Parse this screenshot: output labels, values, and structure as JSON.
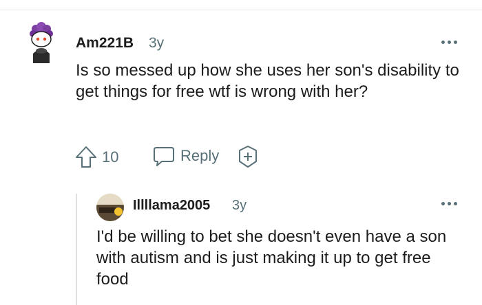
{
  "parent_comment": {
    "username": "Am221B",
    "time": "3y",
    "text": "Is so messed up how she uses her son's disability to get things for free wtf is wrong with her?",
    "vote_count": "10",
    "reply_label": "Reply",
    "avatar_icon": "snoo-avatar-purple-hair-icon"
  },
  "reply_comment": {
    "username": "Illllama2005",
    "time": "3y",
    "text": "I'd be willing to bet she doesn't even have a son with autism and is just making it up to get free food",
    "avatar_icon": "fallout-avatar-icon"
  },
  "icons": {
    "upvote": "upvote-arrow-icon",
    "reply": "speech-bubble-icon",
    "award": "award-plus-icon",
    "more": "more-options-icon"
  },
  "colors": {
    "text": "#1c1c1c",
    "meta": "#576f76",
    "thread_line": "#e0e0e0"
  }
}
